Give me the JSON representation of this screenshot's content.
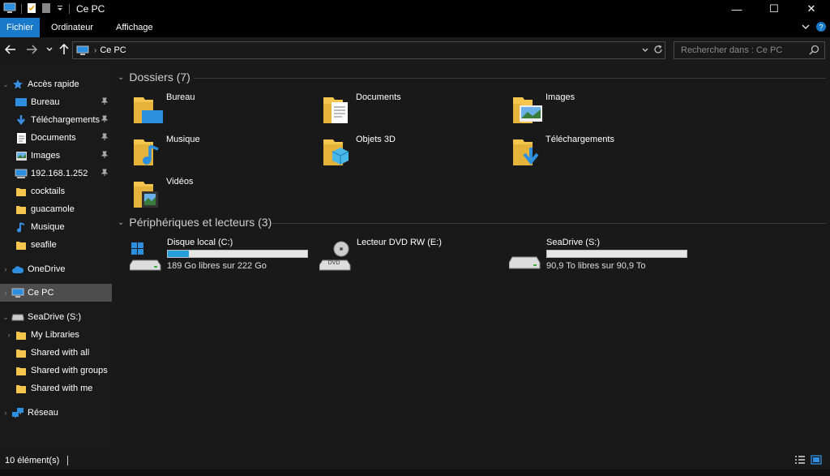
{
  "window": {
    "title": "Ce PC",
    "minimize": "—",
    "maximize": "☐",
    "close": "✕"
  },
  "ribbon": {
    "tabs": [
      "Fichier",
      "Ordinateur",
      "Affichage"
    ]
  },
  "address": {
    "path": "Ce PC",
    "separator": "›"
  },
  "search": {
    "placeholder": "Rechercher dans : Ce PC"
  },
  "sidebar": {
    "items": [
      {
        "label": "Accès rapide",
        "icon": "star-icon"
      },
      {
        "label": "Bureau",
        "icon": "desktop-icon",
        "pinned": true
      },
      {
        "label": "Téléchargements",
        "icon": "download-icon",
        "pinned": true
      },
      {
        "label": "Documents",
        "icon": "documents-icon",
        "pinned": true
      },
      {
        "label": "Images",
        "icon": "images-icon",
        "pinned": true
      },
      {
        "label": "192.168.1.252",
        "icon": "network-drive-icon",
        "pinned": true
      },
      {
        "label": "cocktails",
        "icon": "folder-icon"
      },
      {
        "label": "guacamole",
        "icon": "folder-icon"
      },
      {
        "label": "Musique",
        "icon": "music-icon"
      },
      {
        "label": "seafile",
        "icon": "folder-icon"
      },
      {
        "label": "OneDrive",
        "icon": "cloud-icon"
      },
      {
        "label": "Ce PC",
        "icon": "computer-icon"
      },
      {
        "label": "SeaDrive (S:)",
        "icon": "drive-icon"
      },
      {
        "label": "My Libraries",
        "icon": "folder-icon"
      },
      {
        "label": "Shared with all",
        "icon": "folder-icon"
      },
      {
        "label": "Shared with groups",
        "icon": "folder-icon"
      },
      {
        "label": "Shared with me",
        "icon": "folder-icon"
      },
      {
        "label": "Réseau",
        "icon": "network-icon"
      }
    ]
  },
  "main": {
    "folders_header": "Dossiers (7)",
    "folders": [
      {
        "name": "Bureau",
        "icon": "desktop-folder-icon"
      },
      {
        "name": "Documents",
        "icon": "documents-folder-icon"
      },
      {
        "name": "Images",
        "icon": "images-folder-icon"
      },
      {
        "name": "Musique",
        "icon": "music-folder-icon"
      },
      {
        "name": "Objets 3D",
        "icon": "3d-objects-folder-icon"
      },
      {
        "name": "Téléchargements",
        "icon": "downloads-folder-icon"
      },
      {
        "name": "Vidéos",
        "icon": "videos-folder-icon"
      }
    ],
    "devices_header": "Périphériques et lecteurs (3)",
    "devices": [
      {
        "name": "Disque local (C:)",
        "free": "189 Go libres sur 222 Go",
        "used_fraction": 0.15,
        "icon": "windows-drive-icon"
      },
      {
        "name": "Lecteur DVD RW (E:)",
        "icon": "dvd-drive-icon",
        "dvd_label": "DVD"
      },
      {
        "name": "SeaDrive (S:)",
        "free": "90,9 To libres sur 90,9 To",
        "used_fraction": 0.0,
        "icon": "drive-icon"
      }
    ]
  },
  "status": {
    "count": "10 élément(s)"
  },
  "colors": {
    "accent": "#1979ca",
    "folder": "#f4c64e",
    "bar_fill": "#26a0da",
    "selected": "#4d4d4d"
  }
}
